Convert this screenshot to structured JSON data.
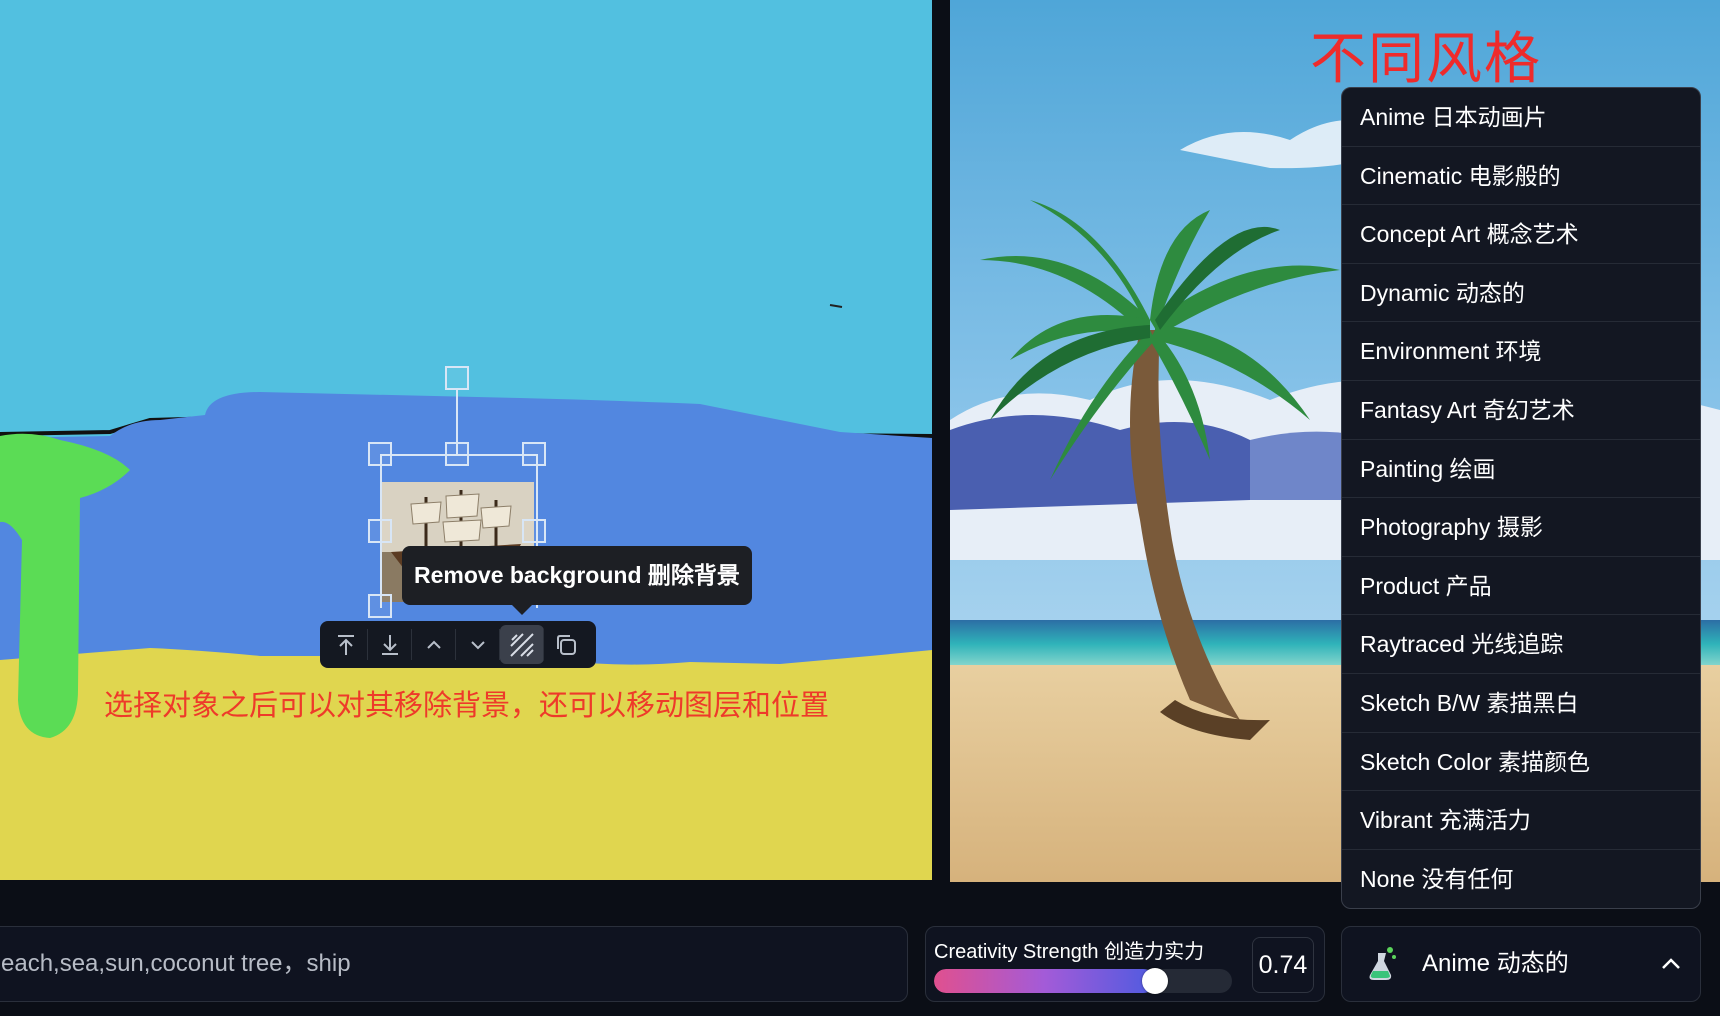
{
  "annotations": {
    "left_note": "选择对象之后可以对其移除背景，还可以移动图层和位置",
    "top_note": "不同风格"
  },
  "canvas": {
    "tooltip": "Remove background 删除背景",
    "toolbar": [
      {
        "name": "bring-to-front-button",
        "icon": "arrow-up-to-line-icon"
      },
      {
        "name": "send-to-back-button",
        "icon": "arrow-down-to-line-icon"
      },
      {
        "name": "move-up-button",
        "icon": "chevron-up-icon"
      },
      {
        "name": "move-down-button",
        "icon": "chevron-down-icon"
      },
      {
        "name": "remove-background-button",
        "icon": "diagonal-lines-icon",
        "active": true
      },
      {
        "name": "duplicate-button",
        "icon": "copy-icon"
      }
    ]
  },
  "style_menu": {
    "items": [
      "Anime 日本动画片",
      "Cinematic 电影般的",
      "Concept Art 概念艺术",
      "Dynamic 动态的",
      "Environment 环境",
      "Fantasy Art 奇幻艺术",
      "Painting 绘画",
      "Photography 摄影",
      "Product 产品",
      "Raytraced 光线追踪",
      "Sketch B/W 素描黑白",
      "Sketch Color 素描颜色",
      "Vibrant 充满活力",
      "None 没有任何"
    ]
  },
  "bottom_bar": {
    "prompt_text": "each,sea,sun,coconut tree，ship",
    "strength_label": "Creativity Strength 创造力实力",
    "strength_value": "0.74",
    "strength_fraction": 0.74,
    "style_selected": "Anime 动态的",
    "style_icon": "flask-icon",
    "chevron_icon": "chevron-up-icon"
  },
  "colors": {
    "sky": "#52c0e0",
    "sea": "#5287e0",
    "sand": "#e0d64f",
    "tree": "#5bdc55",
    "annotation_red": "#ee3a2a",
    "panel_bg": "#131722"
  }
}
